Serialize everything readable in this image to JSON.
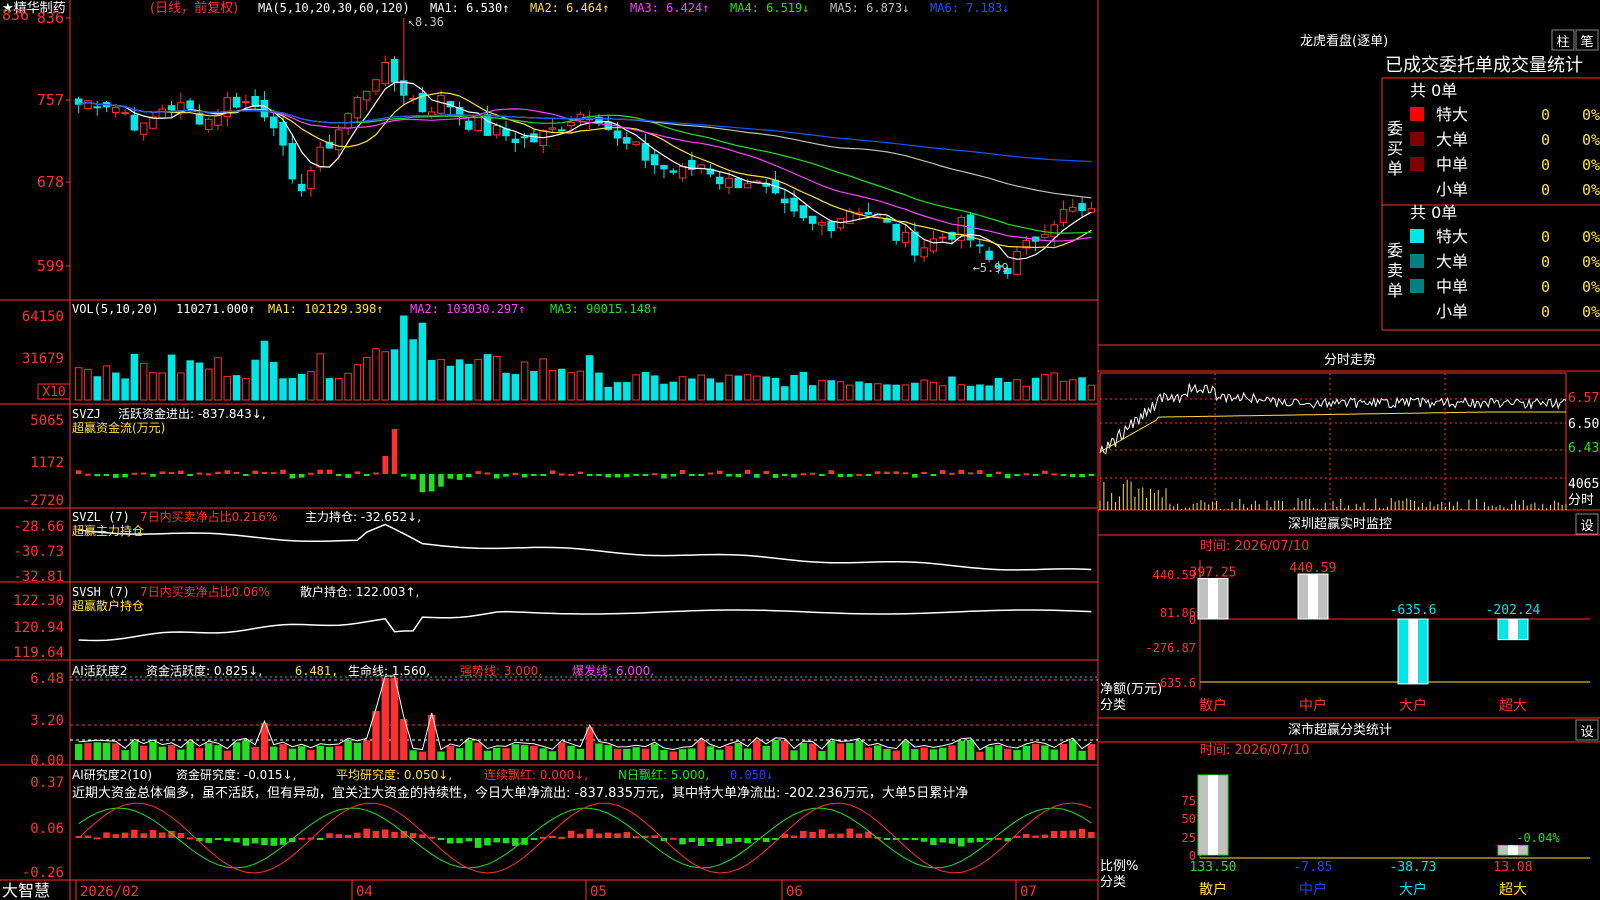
{
  "colors": {
    "up": "#ff3030",
    "down": "#00e5e5",
    "green": "#20e020",
    "yellow": "#ffe040",
    "magenta": "#ff40ff",
    "white": "#ffffff",
    "blue": "#2040ff",
    "grid": "#b00000",
    "axis": "#ff3030"
  },
  "main": {
    "stock": "★精华制药",
    "period": "(日线，前复权)",
    "ma_title": "MA(5,10,20,30,60,120)",
    "ma": [
      {
        "label": "MA1:",
        "value": "6.530",
        "arrow": "↑",
        "color": "#ffffff"
      },
      {
        "label": "MA2:",
        "value": "6.464",
        "arrow": "↑",
        "color": "#ffe040"
      },
      {
        "label": "MA3:",
        "value": "6.424",
        "arrow": "↑",
        "color": "#ff40ff"
      },
      {
        "label": "MA4:",
        "value": "6.519",
        "arrow": "↓",
        "color": "#20e020"
      },
      {
        "label": "MA5:",
        "value": "6.873",
        "arrow": "↓",
        "color": "#c0c0c0"
      },
      {
        "label": "MA6:",
        "value": "7.183",
        "arrow": "↓",
        "color": "#2050ff"
      }
    ],
    "yticks": [
      "836",
      "757",
      "678",
      "599"
    ],
    "high_label": "8.36",
    "low_label": "←5.99"
  },
  "vol": {
    "title": "VOL(5,10,20)",
    "value": "110271.000",
    "ma1": "MA1: 102129.398",
    "ma2": "MA2: 103030.297",
    "ma3": "MA3: 90015.148",
    "yticks": [
      "64150",
      "31679"
    ],
    "unit": "X10"
  },
  "svzj": {
    "title": "SVZJ",
    "name": "活跃资金进出: -837.843",
    "sub": "超赢资金流(万元)",
    "yticks": [
      "5065",
      "1172",
      "-2720"
    ]
  },
  "svzl": {
    "title": "SVZL (7)",
    "t1": "7日内买卖净占比0.216%",
    "t2": "主力持仓: -32.652",
    "sub": "超赢主力持仓",
    "yticks": [
      "-28.66",
      "-30.73",
      "-32.81"
    ]
  },
  "svsh": {
    "title": "SVSH (7)",
    "t1": "7日内买卖净占比0.06%",
    "t2": "散户持仓: 122.003",
    "sub": "超赢散户持仓",
    "yticks": [
      "122.30",
      "120.94",
      "119.64"
    ]
  },
  "ai1": {
    "title": "AI活跃度2",
    "t1": "资金活跃度: 0.825",
    "t2": "6.481",
    "t3": "生命线: 1.560",
    "t4": "强势线: 3.000",
    "t5": "爆发线: 6.000",
    "yticks": [
      "6.48",
      "3.20",
      "0.00"
    ]
  },
  "ai2": {
    "title": "AI研究度2(10)",
    "t1": "资金研究度: -0.015",
    "t2": "平均研究度: 0.050",
    "t3": "连续飘红: 0.000",
    "t4": "N日飘红: 5.000",
    "t5": "0.050",
    "note": "近期大资金总体偏多，虽不活跃，但有异动，宜关注大资金的持续性，今日大单净流出: -837.835万元，其中特大单净流出: -202.236万元，大单5日累计净",
    "yticks": [
      "0.37",
      "0.06",
      "-0.26"
    ]
  },
  "xaxis": {
    "brand": "大智慧",
    "labels": [
      "2026/02",
      "04",
      "05",
      "06",
      "07"
    ]
  },
  "lhb": {
    "title": "龙虎看盘(逐单)",
    "btn1": "柱",
    "btn2": "笔",
    "header": "已成交委托单成交量统计",
    "buy": {
      "count": "共 0单",
      "side": "委买单",
      "rows": [
        {
          "label": "特大",
          "vol": "0",
          "pct": "0%"
        },
        {
          "label": "大单",
          "vol": "0",
          "pct": "0%"
        },
        {
          "label": "中单",
          "vol": "0",
          "pct": "0%"
        },
        {
          "label": "小单",
          "vol": "0",
          "pct": "0%"
        }
      ]
    },
    "sell": {
      "count": "共 0单",
      "side": "委卖单",
      "rows": [
        {
          "label": "特大",
          "vol": "0",
          "pct": "0%"
        },
        {
          "label": "大单",
          "vol": "0",
          "pct": "0%"
        },
        {
          "label": "中单",
          "vol": "0",
          "pct": "0%"
        },
        {
          "label": "小单",
          "vol": "0",
          "pct": "0%"
        }
      ]
    }
  },
  "fenshi": {
    "title": "分时走势",
    "yticks": [
      "6.57",
      "6.50",
      "6.43"
    ],
    "vol_label": "4065",
    "unit": "分时"
  },
  "sz1": {
    "title": "深圳超赢实时监控",
    "btn": "设",
    "time": "时间: 2026/07/10",
    "yticks": [
      "440.59",
      "81.86",
      "0",
      "-276.87",
      "-635.6"
    ],
    "ylabel1": "净额(万元)",
    "ylabel2": "分类",
    "cats": [
      "散户",
      "中户",
      "大户",
      "超大"
    ],
    "values": [
      397.25,
      440.59,
      -635.6,
      -202.24
    ],
    "labels": [
      "397.25",
      "440.59",
      "-635.6",
      "-202.24"
    ]
  },
  "sz2": {
    "title": "深市超赢分类统计",
    "btn": "设",
    "time": "时间: 2026/07/10",
    "yticks": [
      "75",
      "50",
      "25",
      "0"
    ],
    "ylabel1": "比例%",
    "ylabel2": "分类",
    "cats": [
      "散户",
      "中户",
      "大户",
      "超大"
    ],
    "values": [
      133.5,
      -7.85,
      -38.73,
      13.08
    ],
    "labels": [
      "133.50",
      "-7.85",
      "-38.73",
      "13.08"
    ],
    "pct_label": "-0.04%"
  }
}
